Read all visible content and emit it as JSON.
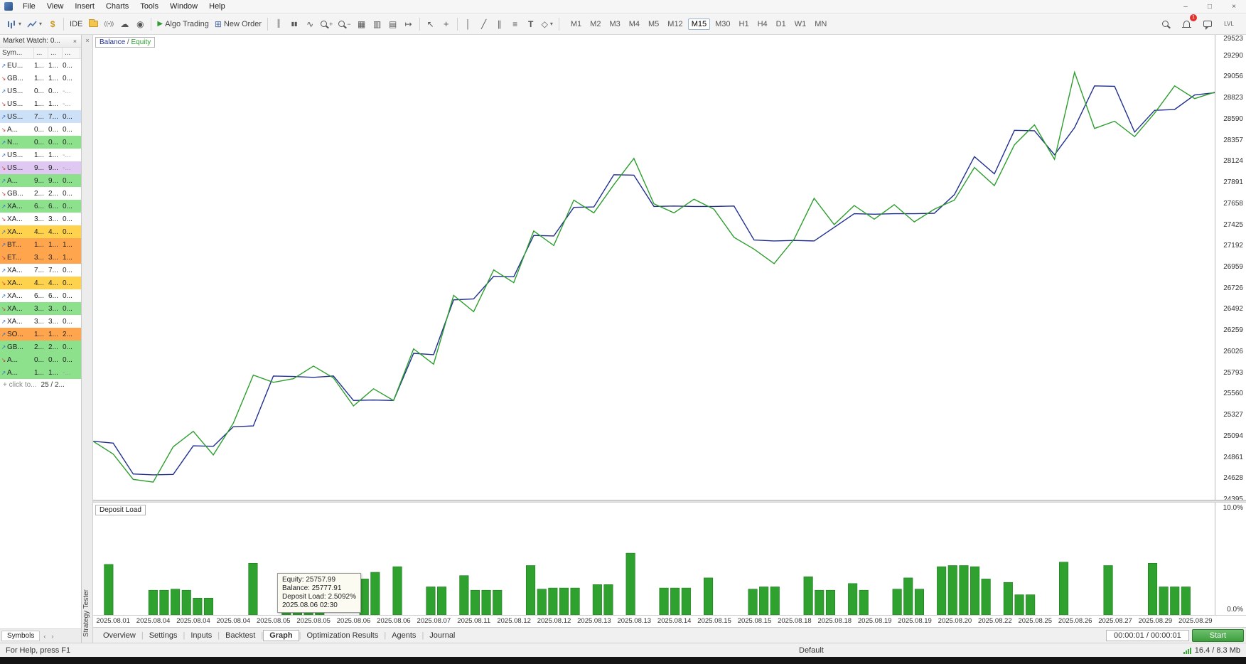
{
  "window": {
    "menu": [
      "File",
      "View",
      "Insert",
      "Charts",
      "Tools",
      "Window",
      "Help"
    ],
    "controls": {
      "minimize": "–",
      "maximize": "□",
      "close": "×"
    }
  },
  "icons": {
    "caret": "▾",
    "close": "×",
    "tab_scroll_left": "‹",
    "tab_scroll_right": "›",
    "row_up": "↗",
    "row_down": "↘"
  },
  "toolbar": {
    "ide_label": "IDE",
    "algo_trading_label": "Algo Trading",
    "new_order_label": "New Order",
    "notification_count": "1",
    "levels_label": "LVL",
    "timeframes": [
      "M1",
      "M2",
      "M3",
      "M4",
      "M5",
      "M12",
      "M15",
      "M30",
      "H1",
      "H4",
      "D1",
      "W1",
      "MN"
    ],
    "active_timeframe": "M15",
    "glyphs": {
      "dollar": "$",
      "broadcast": "((•))",
      "cloud": "☁",
      "community": "◉",
      "play": "▶",
      "order": "⊞",
      "bars": "║",
      "candles": "▮▮",
      "linemode": "∿",
      "grid": "▦",
      "tile": "▥",
      "cascade": "▤",
      "shift": "↦",
      "cursor": "↖",
      "crosshair": "+",
      "vline": "│",
      "trendline": "╱",
      "channel": "∥",
      "fibo": "≡",
      "text_tool": "T",
      "shapes": "◇",
      "zoom_in_sign": "+",
      "zoom_out_sign": "−"
    }
  },
  "market_watch": {
    "title": "Market Watch: 0...",
    "columns": [
      "Sym...",
      "...",
      "...",
      "..."
    ],
    "row_colors": {
      "none": "#ffffff",
      "green": "#8de18d",
      "yellow": "#ffd24d",
      "orange": "#ffa54d",
      "blue": "#cce0f8",
      "purple": "#dfc9f2"
    },
    "rows": [
      {
        "sym": "EU...",
        "v1": "1...",
        "v2": "1...",
        "v3": "0...",
        "bg": "none",
        "dir": "up"
      },
      {
        "sym": "GB...",
        "v1": "1...",
        "v2": "1...",
        "v3": "0...",
        "bg": "none",
        "dir": "down"
      },
      {
        "sym": "US...",
        "v1": "0...",
        "v2": "0...",
        "v3": "-...",
        "bg": "none",
        "dir": "up"
      },
      {
        "sym": "US...",
        "v1": "1...",
        "v2": "1...",
        "v3": "-...",
        "bg": "none",
        "dir": "down"
      },
      {
        "sym": "US...",
        "v1": "7...",
        "v2": "7...",
        "v3": "0...",
        "bg": "blue",
        "dir": "up"
      },
      {
        "sym": "A...",
        "v1": "0...",
        "v2": "0...",
        "v3": "0...",
        "bg": "none",
        "dir": "down"
      },
      {
        "sym": "N...",
        "v1": "0...",
        "v2": "0...",
        "v3": "0...",
        "bg": "green",
        "dir": "up"
      },
      {
        "sym": "US...",
        "v1": "1...",
        "v2": "1...",
        "v3": "-...",
        "bg": "none",
        "dir": "up"
      },
      {
        "sym": "US...",
        "v1": "9...",
        "v2": "9...",
        "v3": "-...",
        "bg": "purple",
        "dir": "down"
      },
      {
        "sym": "A...",
        "v1": "9...",
        "v2": "9...",
        "v3": "0...",
        "bg": "green",
        "dir": "up"
      },
      {
        "sym": "GB...",
        "v1": "2...",
        "v2": "2...",
        "v3": "0...",
        "bg": "none",
        "dir": "down"
      },
      {
        "sym": "XA...",
        "v1": "6...",
        "v2": "6...",
        "v3": "0...",
        "bg": "green",
        "dir": "up"
      },
      {
        "sym": "XA...",
        "v1": "3...",
        "v2": "3...",
        "v3": "0...",
        "bg": "none",
        "dir": "down"
      },
      {
        "sym": "XA...",
        "v1": "4...",
        "v2": "4...",
        "v3": "0...",
        "bg": "yellow",
        "dir": "up"
      },
      {
        "sym": "BT...",
        "v1": "1...",
        "v2": "1...",
        "v3": "1...",
        "bg": "orange",
        "dir": "up"
      },
      {
        "sym": "ET...",
        "v1": "3...",
        "v2": "3...",
        "v3": "1...",
        "bg": "orange",
        "dir": "down"
      },
      {
        "sym": "XA...",
        "v1": "7...",
        "v2": "7...",
        "v3": "0...",
        "bg": "none",
        "dir": "up"
      },
      {
        "sym": "XA...",
        "v1": "4...",
        "v2": "4...",
        "v3": "0...",
        "bg": "yellow",
        "dir": "down"
      },
      {
        "sym": "XA...",
        "v1": "6...",
        "v2": "6...",
        "v3": "0...",
        "bg": "none",
        "dir": "up"
      },
      {
        "sym": "XA...",
        "v1": "3...",
        "v2": "3...",
        "v3": "0...",
        "bg": "green",
        "dir": "down"
      },
      {
        "sym": "XA...",
        "v1": "3...",
        "v2": "3...",
        "v3": "0...",
        "bg": "none",
        "dir": "up"
      },
      {
        "sym": "SO...",
        "v1": "1...",
        "v2": "1...",
        "v3": "2...",
        "bg": "orange",
        "dir": "up"
      },
      {
        "sym": "GB...",
        "v1": "2...",
        "v2": "2...",
        "v3": "0...",
        "bg": "green",
        "dir": "up"
      },
      {
        "sym": "A...",
        "v1": "0...",
        "v2": "0...",
        "v3": "0...",
        "bg": "green",
        "dir": "down"
      },
      {
        "sym": "A...",
        "v1": "1...",
        "v2": "1...",
        "v3": "-...",
        "bg": "green",
        "dir": "up"
      }
    ],
    "footer_add": "+ click to...",
    "footer_count": "25 / 2...",
    "tabs": [
      "Symbols"
    ]
  },
  "tester": {
    "strip_title": "Strategy Tester",
    "legend": {
      "balance": "Balance",
      "sep": " / ",
      "equity": "Equity"
    },
    "deposit_label": "Deposit Load",
    "tabs": [
      "Overview",
      "Settings",
      "Inputs",
      "Backtest",
      "Graph",
      "Optimization Results",
      "Agents",
      "Journal"
    ],
    "active_tab": "Graph",
    "progress": "00:00:01 / 00:00:01",
    "start_label": "Start",
    "tooltip": {
      "equity": "Equity: 25757.99",
      "balance": "Balance: 25777.91",
      "deposit_load": "Deposit Load: 2.5092%",
      "time": "2025.08.06 02:30"
    }
  },
  "status_bar": {
    "help": "For Help, press F1",
    "profile": "Default",
    "memory": "16.4 / 8.3 Mb"
  },
  "colors": {
    "accent_green": "#3f9e3f",
    "balance_line": "#1f2f8f",
    "equity_line": "#2d9e2d",
    "bar_fill": "#2fa12f"
  },
  "chart_data": [
    {
      "type": "line",
      "title": "Balance / Equity",
      "ylim": [
        24395,
        29523
      ],
      "yticks": [
        "29523",
        "29290",
        "29056",
        "28823",
        "28590",
        "28357",
        "28124",
        "27891",
        "27658",
        "27425",
        "27192",
        "26959",
        "26726",
        "26492",
        "26259",
        "26026",
        "25793",
        "25560",
        "25327",
        "25094",
        "24861",
        "24628",
        "24395"
      ],
      "x_labels": [
        "2025.08.01",
        "2025.08.04",
        "2025.08.04",
        "2025.08.04",
        "2025.08.05",
        "2025.08.05",
        "2025.08.06",
        "2025.08.06",
        "2025.08.07",
        "2025.08.11",
        "2025.08.12",
        "2025.08.12",
        "2025.08.13",
        "2025.08.13",
        "2025.08.14",
        "2025.08.15",
        "2025.08.15",
        "2025.08.18",
        "2025.08.18",
        "2025.08.19",
        "2025.08.19",
        "2025.08.20",
        "2025.08.22",
        "2025.08.25",
        "2025.08.26",
        "2025.08.27",
        "2025.08.29",
        "2025.08.29"
      ],
      "series": [
        {
          "name": "Balance",
          "color": "#1f2f8f",
          "values": [
            25040,
            25020,
            24680,
            24670,
            24675,
            24990,
            24985,
            25200,
            25210,
            25760,
            25755,
            25745,
            25760,
            25490,
            25495,
            25490,
            26010,
            25995,
            26600,
            26610,
            26860,
            26855,
            27310,
            27305,
            27620,
            27625,
            27980,
            27975,
            27630,
            27635,
            27630,
            27630,
            27635,
            27260,
            27250,
            27255,
            27250,
            27400,
            27550,
            27545,
            27550,
            27550,
            27555,
            27760,
            28180,
            27990,
            28470,
            28465,
            28200,
            28500,
            28960,
            28955,
            28450,
            28690,
            28700,
            28860,
            28885
          ]
        },
        {
          "name": "Equity",
          "color": "#2d9e2d",
          "values": [
            25040,
            24900,
            24620,
            24590,
            24980,
            25150,
            24890,
            25240,
            25770,
            25690,
            25730,
            25870,
            25740,
            25430,
            25620,
            25490,
            26060,
            25890,
            26650,
            26470,
            26930,
            26790,
            27360,
            27200,
            27700,
            27560,
            27870,
            28160,
            27660,
            27560,
            27710,
            27600,
            27290,
            27160,
            27000,
            27270,
            27720,
            27430,
            27640,
            27490,
            27650,
            27460,
            27600,
            27700,
            28060,
            27860,
            28310,
            28530,
            28150,
            29110,
            28490,
            28570,
            28400,
            28660,
            28960,
            28820,
            28890
          ]
        }
      ]
    },
    {
      "type": "bar",
      "title": "Deposit Load",
      "ylim": [
        0,
        10
      ],
      "yticks": [
        "10.0%",
        "0.0%"
      ],
      "color": "#2fa12f",
      "edge_color": "#1e7a1e",
      "values": [
        0,
        4.5,
        0,
        0,
        0,
        2.2,
        2.2,
        2.3,
        2.2,
        1.5,
        1.5,
        0,
        0,
        0,
        4.6,
        0,
        0,
        2.0,
        2.0,
        2.0,
        2.0,
        0,
        0,
        0,
        3.2,
        3.8,
        0,
        4.3,
        0,
        0,
        2.5,
        2.5,
        0,
        3.5,
        2.2,
        2.2,
        2.2,
        0,
        0,
        4.4,
        2.3,
        2.4,
        2.4,
        2.4,
        0,
        2.7,
        2.7,
        0,
        5.5,
        0,
        0,
        2.4,
        2.4,
        2.4,
        0,
        3.3,
        0,
        0,
        0,
        2.3,
        2.5,
        2.5,
        0,
        0,
        3.4,
        2.2,
        2.2,
        0,
        2.8,
        2.2,
        0,
        0,
        2.3,
        3.3,
        2.3,
        0,
        4.3,
        4.4,
        4.4,
        4.3,
        3.2,
        0,
        2.9,
        1.8,
        1.8,
        0,
        0,
        4.7,
        0,
        0,
        0,
        4.4,
        0,
        0,
        0,
        4.6,
        2.5,
        2.5,
        2.5,
        0,
        0
      ]
    }
  ]
}
